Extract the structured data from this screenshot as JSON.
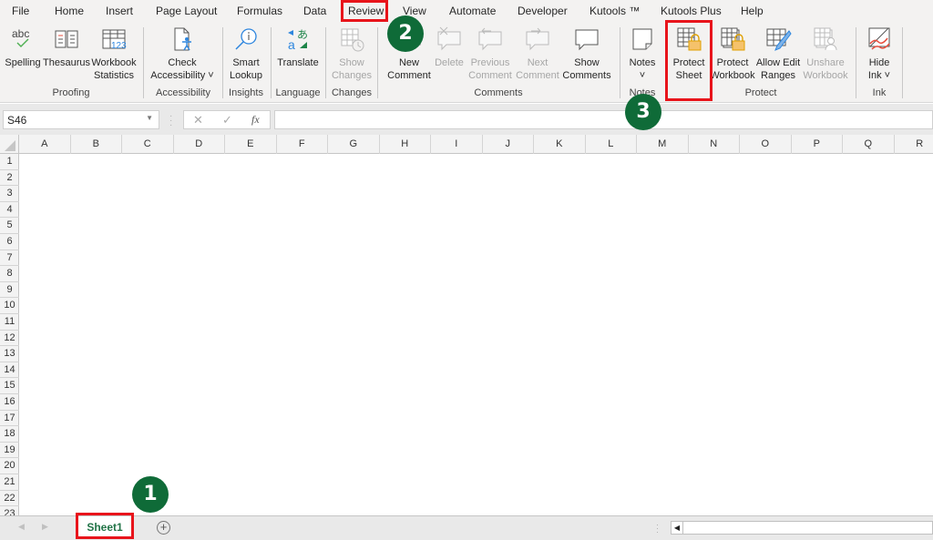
{
  "menu_tabs": [
    "File",
    "Home",
    "Insert",
    "Page Layout",
    "Formulas",
    "Data",
    "Review",
    "View",
    "Automate",
    "Developer",
    "Kutools ™",
    "Kutools Plus",
    "Help"
  ],
  "active_tab": "Review",
  "ribbon": {
    "groups": {
      "proofing": "Proofing",
      "accessibility": "Accessibility",
      "insights": "Insights",
      "language": "Language",
      "changes": "Changes",
      "comments": "Comments",
      "notes": "Notes",
      "protect": "Protect",
      "ink": "Ink"
    },
    "buttons": {
      "spelling": {
        "line1": "Spelling",
        "line2": "",
        "icon_text": "abc"
      },
      "thesaurus": {
        "line1": "Thesaurus",
        "line2": ""
      },
      "workbook_statistics": {
        "line1": "Workbook",
        "line2": "Statistics",
        "icon_text": "123"
      },
      "check_accessibility": {
        "line1": "Check",
        "line2": "Accessibility ˅"
      },
      "smart_lookup": {
        "line1": "Smart",
        "line2": "Lookup"
      },
      "translate": {
        "line1": "Translate",
        "line2": ""
      },
      "show_changes": {
        "line1": "Show",
        "line2": "Changes"
      },
      "new_comment": {
        "line1": "New",
        "line2": "Comment"
      },
      "delete": {
        "line1": "Delete",
        "line2": ""
      },
      "previous_comment": {
        "line1": "Previous",
        "line2": "Comment"
      },
      "next_comment": {
        "line1": "Next",
        "line2": "Comment"
      },
      "show_comments": {
        "line1": "Show",
        "line2": "Comments"
      },
      "notes": {
        "line1": "Notes",
        "line2": "˅"
      },
      "protect_sheet": {
        "line1": "Protect",
        "line2": "Sheet"
      },
      "protect_workbook": {
        "line1": "Protect",
        "line2": "Workbook"
      },
      "allow_edit_ranges": {
        "line1": "Allow Edit",
        "line2": "Ranges"
      },
      "unshare_workbook": {
        "line1": "Unshare",
        "line2": "Workbook"
      },
      "hide_ink": {
        "line1": "Hide",
        "line2": "Ink ˅"
      }
    }
  },
  "formula_bar": {
    "name_box": "S46",
    "cancel_icon": "✕",
    "enter_icon": "✓",
    "fx_label": "fx",
    "formula_value": ""
  },
  "columns": [
    "A",
    "B",
    "C",
    "D",
    "E",
    "F",
    "G",
    "H",
    "I",
    "J",
    "K",
    "L",
    "M",
    "N",
    "O",
    "P",
    "Q",
    "R"
  ],
  "rows": [
    "1",
    "2",
    "3",
    "4",
    "5",
    "6",
    "7",
    "8",
    "9",
    "10",
    "11",
    "12",
    "13",
    "14",
    "15",
    "16",
    "17",
    "18",
    "19",
    "20",
    "21",
    "22",
    "23"
  ],
  "sheets": [
    {
      "name": "Sheet1",
      "active": true
    }
  ],
  "annotations": [
    {
      "number": "1",
      "target": "Sheet1 tab"
    },
    {
      "number": "2",
      "target": "Review tab"
    },
    {
      "number": "3",
      "target": "Protect Sheet button"
    }
  ],
  "colors": {
    "badge": "#0f6b38",
    "highlight": "#e8141b",
    "sheet_tab_text": "#217346"
  }
}
